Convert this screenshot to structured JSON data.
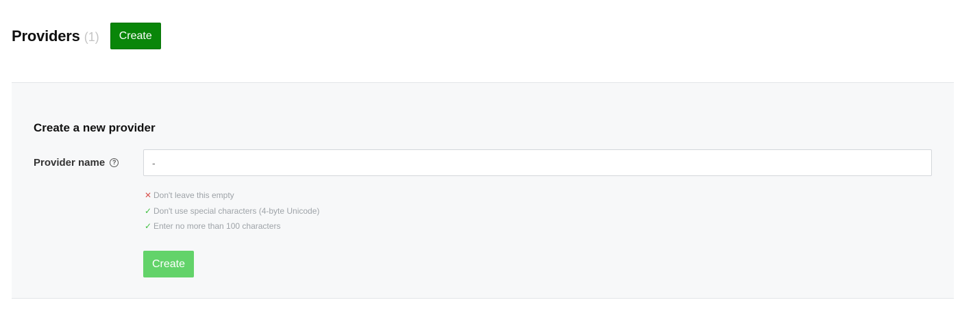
{
  "header": {
    "title": "Providers",
    "count": "(1)",
    "create_label": "Create"
  },
  "form": {
    "title": "Create a new provider",
    "provider_name_label": "Provider name",
    "help_glyph": "?",
    "provider_name_value": "-",
    "validation": [
      {
        "icon": "✕",
        "status": "fail",
        "text": "Don't leave this empty"
      },
      {
        "icon": "✓",
        "status": "pass",
        "text": "Don't use special characters (4-byte Unicode)"
      },
      {
        "icon": "✓",
        "status": "pass",
        "text": "Enter no more than 100 characters"
      }
    ],
    "submit_label": "Create",
    "submit_enabled": false
  },
  "colors": {
    "primary_button": "#098609",
    "disabled_button": "#63d36a",
    "fail": "#d9534f",
    "pass": "#3fbf3f",
    "panel_bg": "#f7f8f9"
  }
}
